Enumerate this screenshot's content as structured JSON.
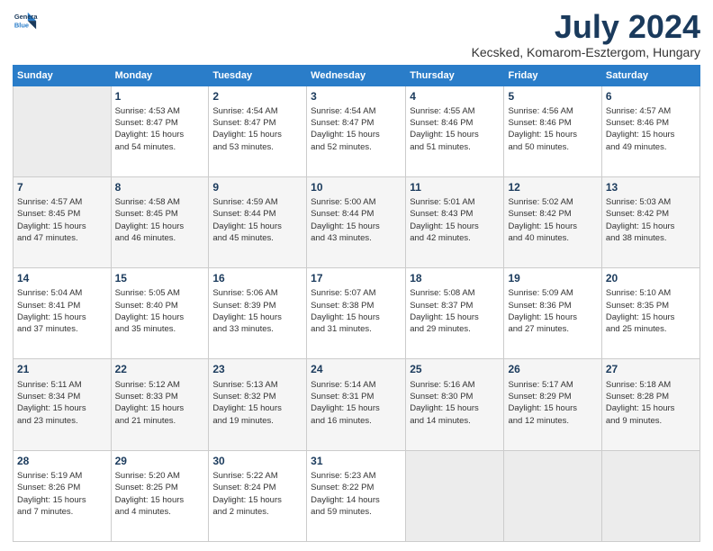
{
  "header": {
    "logo_line1": "General",
    "logo_line2": "Blue",
    "title": "July 2024",
    "subtitle": "Kecsked, Komarom-Esztergom, Hungary"
  },
  "days_of_week": [
    "Sunday",
    "Monday",
    "Tuesday",
    "Wednesday",
    "Thursday",
    "Friday",
    "Saturday"
  ],
  "weeks": [
    [
      {
        "day": "",
        "info": ""
      },
      {
        "day": "1",
        "info": "Sunrise: 4:53 AM\nSunset: 8:47 PM\nDaylight: 15 hours\nand 54 minutes."
      },
      {
        "day": "2",
        "info": "Sunrise: 4:54 AM\nSunset: 8:47 PM\nDaylight: 15 hours\nand 53 minutes."
      },
      {
        "day": "3",
        "info": "Sunrise: 4:54 AM\nSunset: 8:47 PM\nDaylight: 15 hours\nand 52 minutes."
      },
      {
        "day": "4",
        "info": "Sunrise: 4:55 AM\nSunset: 8:46 PM\nDaylight: 15 hours\nand 51 minutes."
      },
      {
        "day": "5",
        "info": "Sunrise: 4:56 AM\nSunset: 8:46 PM\nDaylight: 15 hours\nand 50 minutes."
      },
      {
        "day": "6",
        "info": "Sunrise: 4:57 AM\nSunset: 8:46 PM\nDaylight: 15 hours\nand 49 minutes."
      }
    ],
    [
      {
        "day": "7",
        "info": "Sunrise: 4:57 AM\nSunset: 8:45 PM\nDaylight: 15 hours\nand 47 minutes."
      },
      {
        "day": "8",
        "info": "Sunrise: 4:58 AM\nSunset: 8:45 PM\nDaylight: 15 hours\nand 46 minutes."
      },
      {
        "day": "9",
        "info": "Sunrise: 4:59 AM\nSunset: 8:44 PM\nDaylight: 15 hours\nand 45 minutes."
      },
      {
        "day": "10",
        "info": "Sunrise: 5:00 AM\nSunset: 8:44 PM\nDaylight: 15 hours\nand 43 minutes."
      },
      {
        "day": "11",
        "info": "Sunrise: 5:01 AM\nSunset: 8:43 PM\nDaylight: 15 hours\nand 42 minutes."
      },
      {
        "day": "12",
        "info": "Sunrise: 5:02 AM\nSunset: 8:42 PM\nDaylight: 15 hours\nand 40 minutes."
      },
      {
        "day": "13",
        "info": "Sunrise: 5:03 AM\nSunset: 8:42 PM\nDaylight: 15 hours\nand 38 minutes."
      }
    ],
    [
      {
        "day": "14",
        "info": "Sunrise: 5:04 AM\nSunset: 8:41 PM\nDaylight: 15 hours\nand 37 minutes."
      },
      {
        "day": "15",
        "info": "Sunrise: 5:05 AM\nSunset: 8:40 PM\nDaylight: 15 hours\nand 35 minutes."
      },
      {
        "day": "16",
        "info": "Sunrise: 5:06 AM\nSunset: 8:39 PM\nDaylight: 15 hours\nand 33 minutes."
      },
      {
        "day": "17",
        "info": "Sunrise: 5:07 AM\nSunset: 8:38 PM\nDaylight: 15 hours\nand 31 minutes."
      },
      {
        "day": "18",
        "info": "Sunrise: 5:08 AM\nSunset: 8:37 PM\nDaylight: 15 hours\nand 29 minutes."
      },
      {
        "day": "19",
        "info": "Sunrise: 5:09 AM\nSunset: 8:36 PM\nDaylight: 15 hours\nand 27 minutes."
      },
      {
        "day": "20",
        "info": "Sunrise: 5:10 AM\nSunset: 8:35 PM\nDaylight: 15 hours\nand 25 minutes."
      }
    ],
    [
      {
        "day": "21",
        "info": "Sunrise: 5:11 AM\nSunset: 8:34 PM\nDaylight: 15 hours\nand 23 minutes."
      },
      {
        "day": "22",
        "info": "Sunrise: 5:12 AM\nSunset: 8:33 PM\nDaylight: 15 hours\nand 21 minutes."
      },
      {
        "day": "23",
        "info": "Sunrise: 5:13 AM\nSunset: 8:32 PM\nDaylight: 15 hours\nand 19 minutes."
      },
      {
        "day": "24",
        "info": "Sunrise: 5:14 AM\nSunset: 8:31 PM\nDaylight: 15 hours\nand 16 minutes."
      },
      {
        "day": "25",
        "info": "Sunrise: 5:16 AM\nSunset: 8:30 PM\nDaylight: 15 hours\nand 14 minutes."
      },
      {
        "day": "26",
        "info": "Sunrise: 5:17 AM\nSunset: 8:29 PM\nDaylight: 15 hours\nand 12 minutes."
      },
      {
        "day": "27",
        "info": "Sunrise: 5:18 AM\nSunset: 8:28 PM\nDaylight: 15 hours\nand 9 minutes."
      }
    ],
    [
      {
        "day": "28",
        "info": "Sunrise: 5:19 AM\nSunset: 8:26 PM\nDaylight: 15 hours\nand 7 minutes."
      },
      {
        "day": "29",
        "info": "Sunrise: 5:20 AM\nSunset: 8:25 PM\nDaylight: 15 hours\nand 4 minutes."
      },
      {
        "day": "30",
        "info": "Sunrise: 5:22 AM\nSunset: 8:24 PM\nDaylight: 15 hours\nand 2 minutes."
      },
      {
        "day": "31",
        "info": "Sunrise: 5:23 AM\nSunset: 8:22 PM\nDaylight: 14 hours\nand 59 minutes."
      },
      {
        "day": "",
        "info": ""
      },
      {
        "day": "",
        "info": ""
      },
      {
        "day": "",
        "info": ""
      }
    ]
  ]
}
